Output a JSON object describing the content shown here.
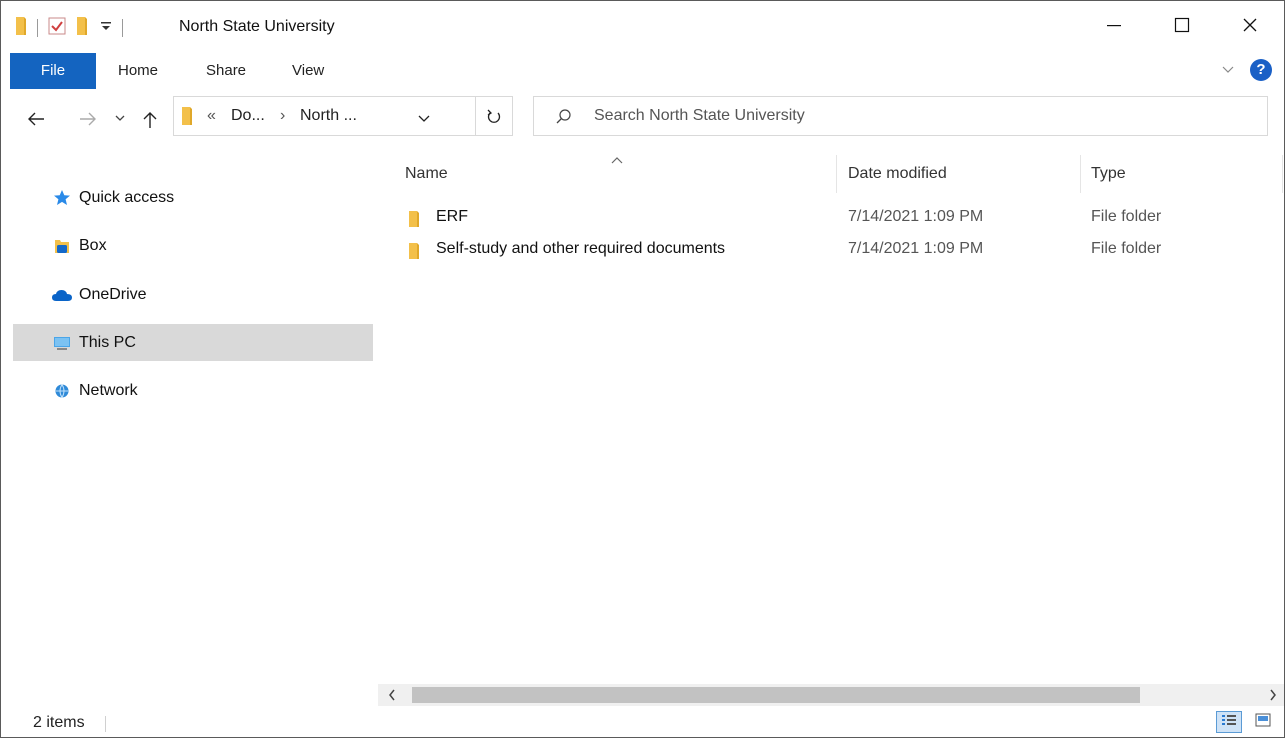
{
  "window": {
    "title": "North State University",
    "controls": {
      "minimize": "minimize-icon",
      "maximize": "maximize-icon",
      "close": "close-icon"
    }
  },
  "ribbon": {
    "tabs": [
      {
        "label": "File"
      },
      {
        "label": "Home"
      },
      {
        "label": "Share"
      },
      {
        "label": "View"
      }
    ]
  },
  "address": {
    "overflow": "«",
    "crumbs": [
      "Do...",
      "North ..."
    ],
    "separator": "›"
  },
  "search": {
    "placeholder": "Search North State University"
  },
  "sidebar": {
    "items": [
      {
        "label": "Quick access",
        "icon": "star-icon",
        "selected": false
      },
      {
        "label": "Box",
        "icon": "box-icon",
        "selected": false
      },
      {
        "label": "OneDrive",
        "icon": "cloud-icon",
        "selected": false
      },
      {
        "label": "This PC",
        "icon": "computer-icon",
        "selected": true
      },
      {
        "label": "Network",
        "icon": "network-icon",
        "selected": false
      }
    ]
  },
  "list": {
    "columns": {
      "name": "Name",
      "date": "Date modified",
      "type": "Type"
    },
    "rows": [
      {
        "name": "ERF",
        "date": "7/14/2021 1:09 PM",
        "type": "File folder"
      },
      {
        "name": "Self-study and other required documents",
        "date": "7/14/2021 1:09 PM",
        "type": "File folder"
      }
    ]
  },
  "status": {
    "count": "2 items"
  },
  "colors": {
    "accent": "#1464c0",
    "folder": "#f3c04a",
    "selected": "#d9d9d9"
  }
}
